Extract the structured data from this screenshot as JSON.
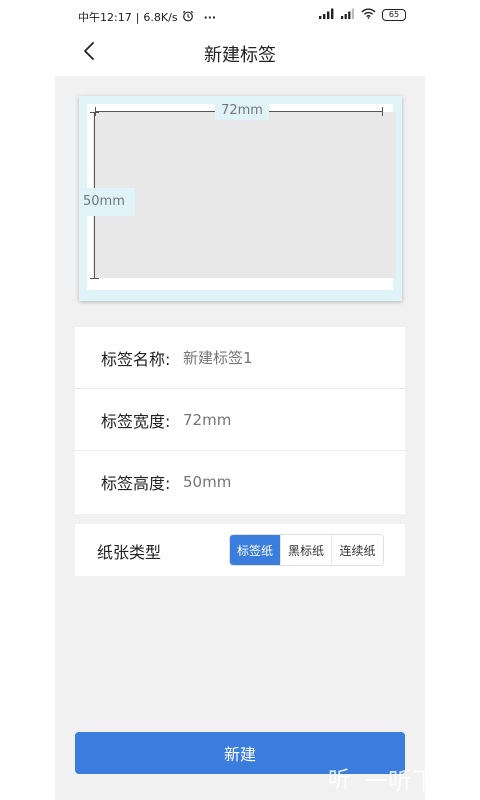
{
  "status_bar": {
    "time": "中午12:17",
    "speed": "6.8K/s",
    "more": "···",
    "network_1": "4G",
    "battery": "65"
  },
  "nav": {
    "title": "新建标签"
  },
  "preview": {
    "width_label": "72mm",
    "height_label": "50mm"
  },
  "form": {
    "name_label": "标签名称:",
    "name_placeholder": "新建标签1",
    "width_label": "标签宽度:",
    "width_placeholder": "72mm",
    "height_label": "标签高度:",
    "height_placeholder": "50mm"
  },
  "paper_type": {
    "label": "纸张类型",
    "options": [
      "标签纸",
      "黑标纸",
      "连续纸"
    ],
    "selected": "标签纸"
  },
  "create_button": "新建",
  "watermark": {
    "icon": "听",
    "text": "一听下载"
  },
  "colors": {
    "accent": "#3b7ddd",
    "preview_border": "#dff3f9",
    "background": "#f1f1f1"
  }
}
